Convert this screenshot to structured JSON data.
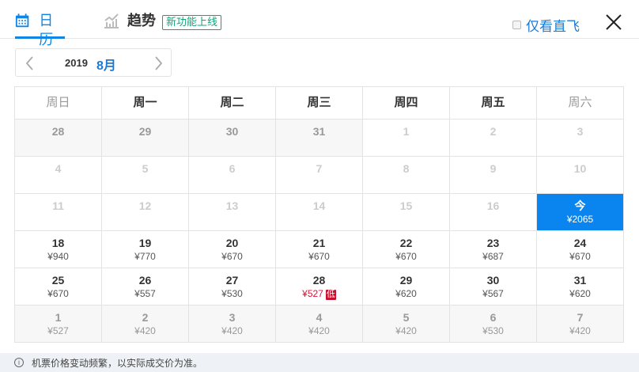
{
  "tabs": [
    {
      "label": "日历",
      "icon": "calendar-icon"
    },
    {
      "label": "趋势",
      "icon": "trend-chart-icon",
      "badge": "新功能上线"
    }
  ],
  "direct_only": {
    "label": "仅看直飞",
    "checked": false
  },
  "month_nav": {
    "year": "2019",
    "month": "8月"
  },
  "weekdays": [
    "周日",
    "周一",
    "周二",
    "周三",
    "周四",
    "周五",
    "周六"
  ],
  "weeks": [
    [
      {
        "d": "28",
        "s": "prev"
      },
      {
        "d": "29",
        "s": "prev"
      },
      {
        "d": "30",
        "s": "prev"
      },
      {
        "d": "31",
        "s": "prev"
      },
      {
        "d": "1",
        "s": "past"
      },
      {
        "d": "2",
        "s": "past"
      },
      {
        "d": "3",
        "s": "past"
      }
    ],
    [
      {
        "d": "4",
        "s": "past"
      },
      {
        "d": "5",
        "s": "past"
      },
      {
        "d": "6",
        "s": "past"
      },
      {
        "d": "7",
        "s": "past"
      },
      {
        "d": "8",
        "s": "past"
      },
      {
        "d": "9",
        "s": "past"
      },
      {
        "d": "10",
        "s": "past"
      }
    ],
    [
      {
        "d": "11",
        "s": "past"
      },
      {
        "d": "12",
        "s": "past"
      },
      {
        "d": "13",
        "s": "past"
      },
      {
        "d": "14",
        "s": "past"
      },
      {
        "d": "15",
        "s": "past"
      },
      {
        "d": "16",
        "s": "past"
      },
      {
        "d": "今",
        "p": "¥2065",
        "s": "today"
      }
    ],
    [
      {
        "d": "18",
        "p": "¥940"
      },
      {
        "d": "19",
        "p": "¥770"
      },
      {
        "d": "20",
        "p": "¥670"
      },
      {
        "d": "21",
        "p": "¥670"
      },
      {
        "d": "22",
        "p": "¥670"
      },
      {
        "d": "23",
        "p": "¥687"
      },
      {
        "d": "24",
        "p": "¥670"
      }
    ],
    [
      {
        "d": "25",
        "p": "¥670"
      },
      {
        "d": "26",
        "p": "¥557"
      },
      {
        "d": "27",
        "p": "¥530"
      },
      {
        "d": "28",
        "p": "¥527",
        "s": "low",
        "tag": "低"
      },
      {
        "d": "29",
        "p": "¥620"
      },
      {
        "d": "30",
        "p": "¥567"
      },
      {
        "d": "31",
        "p": "¥620"
      }
    ],
    [
      {
        "d": "1",
        "p": "¥527",
        "s": "next"
      },
      {
        "d": "2",
        "p": "¥420",
        "s": "next"
      },
      {
        "d": "3",
        "p": "¥420",
        "s": "next"
      },
      {
        "d": "4",
        "p": "¥420",
        "s": "next"
      },
      {
        "d": "5",
        "p": "¥420",
        "s": "next"
      },
      {
        "d": "6",
        "p": "¥530",
        "s": "next"
      },
      {
        "d": "7",
        "p": "¥420",
        "s": "next"
      }
    ]
  ],
  "footer": {
    "text": "机票价格变动频繁，以实际成交价为准。"
  },
  "colors": {
    "accent": "#0f86e6",
    "low": "#d4163d",
    "badge": "#13a37c"
  }
}
